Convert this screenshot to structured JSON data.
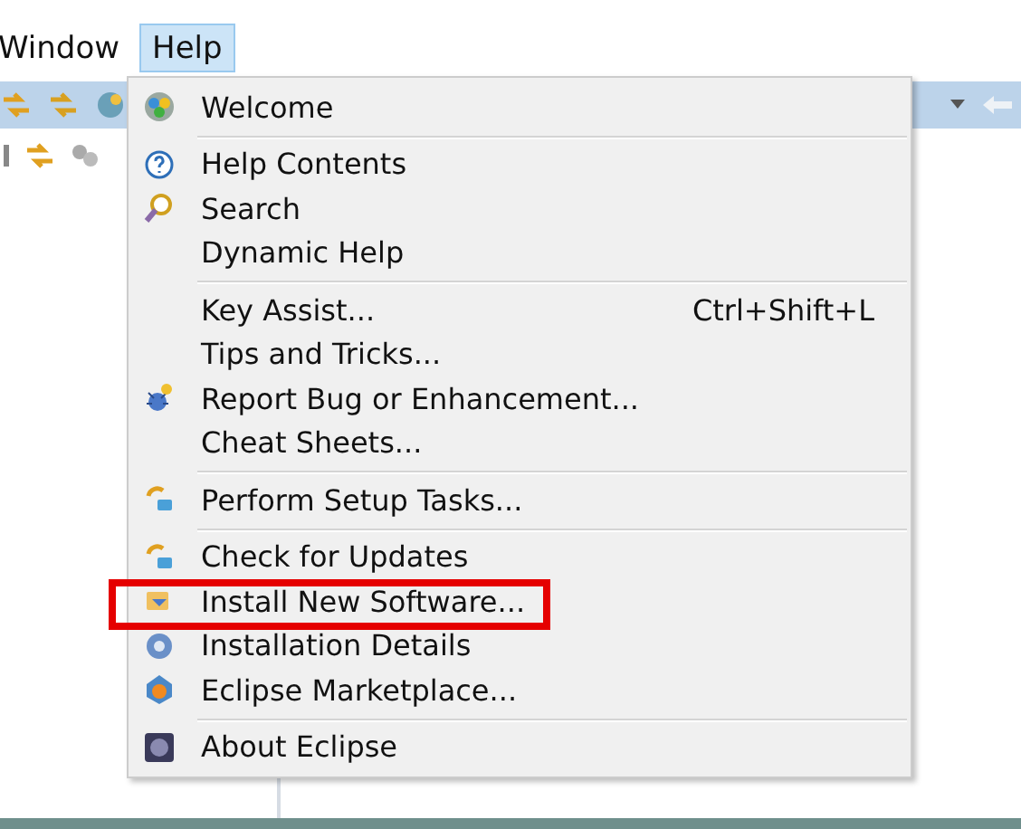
{
  "menu_bar": [
    {
      "label": "Window",
      "selected": false
    },
    {
      "label": "Help",
      "selected": true
    }
  ],
  "help_menu": {
    "sections": [
      [
        {
          "label": "Welcome",
          "highlighted": false
        }
      ],
      [
        {
          "label": "Help Contents",
          "highlighted": false
        },
        {
          "label": "Search",
          "highlighted": false
        },
        {
          "label": "Dynamic Help",
          "highlighted": false
        }
      ],
      [
        {
          "label": "Key Assist...",
          "shortcut": "Ctrl+Shift+L",
          "highlighted": false
        },
        {
          "label": "Tips and Tricks...",
          "highlighted": false
        },
        {
          "label": "Report Bug or Enhancement...",
          "highlighted": false
        },
        {
          "label": "Cheat Sheets...",
          "highlighted": false
        }
      ],
      [
        {
          "label": "Perform Setup Tasks...",
          "highlighted": false
        }
      ],
      [
        {
          "label": "Check for Updates",
          "highlighted": false
        },
        {
          "label": "Install New Software...",
          "highlighted": true
        },
        {
          "label": "Installation Details",
          "highlighted": false
        },
        {
          "label": "Eclipse Marketplace...",
          "highlighted": false
        }
      ],
      [
        {
          "label": "About Eclipse",
          "highlighted": false
        }
      ]
    ]
  }
}
